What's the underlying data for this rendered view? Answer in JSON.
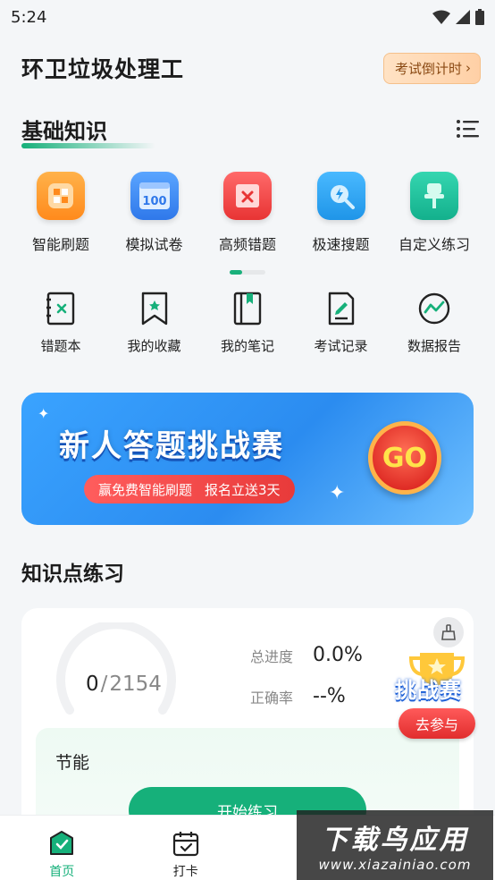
{
  "status_bar": {
    "time": "5:24"
  },
  "header": {
    "title": "环卫垃圾处理工",
    "countdown_label": "考试倒计时"
  },
  "section": {
    "title": "基础知识"
  },
  "features": [
    {
      "label": "智能刷题",
      "icon": "smart-practice-icon",
      "color": "#ff9b2e"
    },
    {
      "label": "模拟试卷",
      "icon": "mock-exam-icon",
      "color": "#3d8df5",
      "badge": "100"
    },
    {
      "label": "高频错题",
      "icon": "frequent-errors-icon",
      "color": "#f44a4a"
    },
    {
      "label": "极速搜题",
      "icon": "quick-search-icon",
      "color": "#2fa8f0"
    },
    {
      "label": "自定义练习",
      "icon": "custom-practice-icon",
      "color": "#1cc3a0"
    }
  ],
  "tools": [
    {
      "label": "错题本",
      "icon": "error-book-icon"
    },
    {
      "label": "我的收藏",
      "icon": "favorites-icon"
    },
    {
      "label": "我的笔记",
      "icon": "notes-icon"
    },
    {
      "label": "考试记录",
      "icon": "exam-record-icon"
    },
    {
      "label": "数据报告",
      "icon": "data-report-icon"
    }
  ],
  "banner": {
    "title": "新人答题挑战赛",
    "sub1": "赢免费智能刷题",
    "sub2": "报名立送3天",
    "go": "GO"
  },
  "knowledge": {
    "title": "知识点练习",
    "done": "0",
    "sep": "/",
    "total": "2154",
    "progress_label": "总进度",
    "progress_value": "0.0%",
    "accuracy_label": "正确率",
    "accuracy_value": "--%",
    "subject": "节能",
    "start_label": "开始练习"
  },
  "floating": {
    "challenge": "挑战赛",
    "join": "去参与"
  },
  "tabbar": [
    {
      "label": "首页",
      "icon": "home-icon",
      "active": true
    },
    {
      "label": "打卡",
      "icon": "checkin-icon",
      "active": false
    },
    {
      "label": "",
      "icon": "",
      "active": false
    },
    {
      "label": "",
      "icon": "",
      "active": false
    }
  ],
  "watermark": {
    "big": "下载鸟应用",
    "small": "www.xiazainiao.com"
  }
}
